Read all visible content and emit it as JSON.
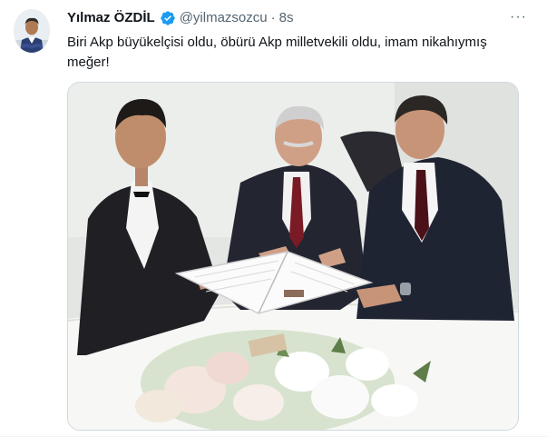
{
  "tweet": {
    "display_name": "Yılmaz ÖZDİL",
    "handle": "@yilmazsozcu",
    "separator": "·",
    "timestamp": "8s",
    "text": "Biri Akp büyükelçisi oldu, öbürü Akp milletvekili oldu, imam nikahıymış meğer!",
    "more_icon_text": "···",
    "avatar_icon": "avatar-person",
    "verified_icon": "verified-badge",
    "colors": {
      "verified": "#1d9bf0",
      "secondary_text": "#536471"
    }
  },
  "media": {
    "kind": "photo",
    "description_icon": "wedding-ceremony-photo"
  }
}
